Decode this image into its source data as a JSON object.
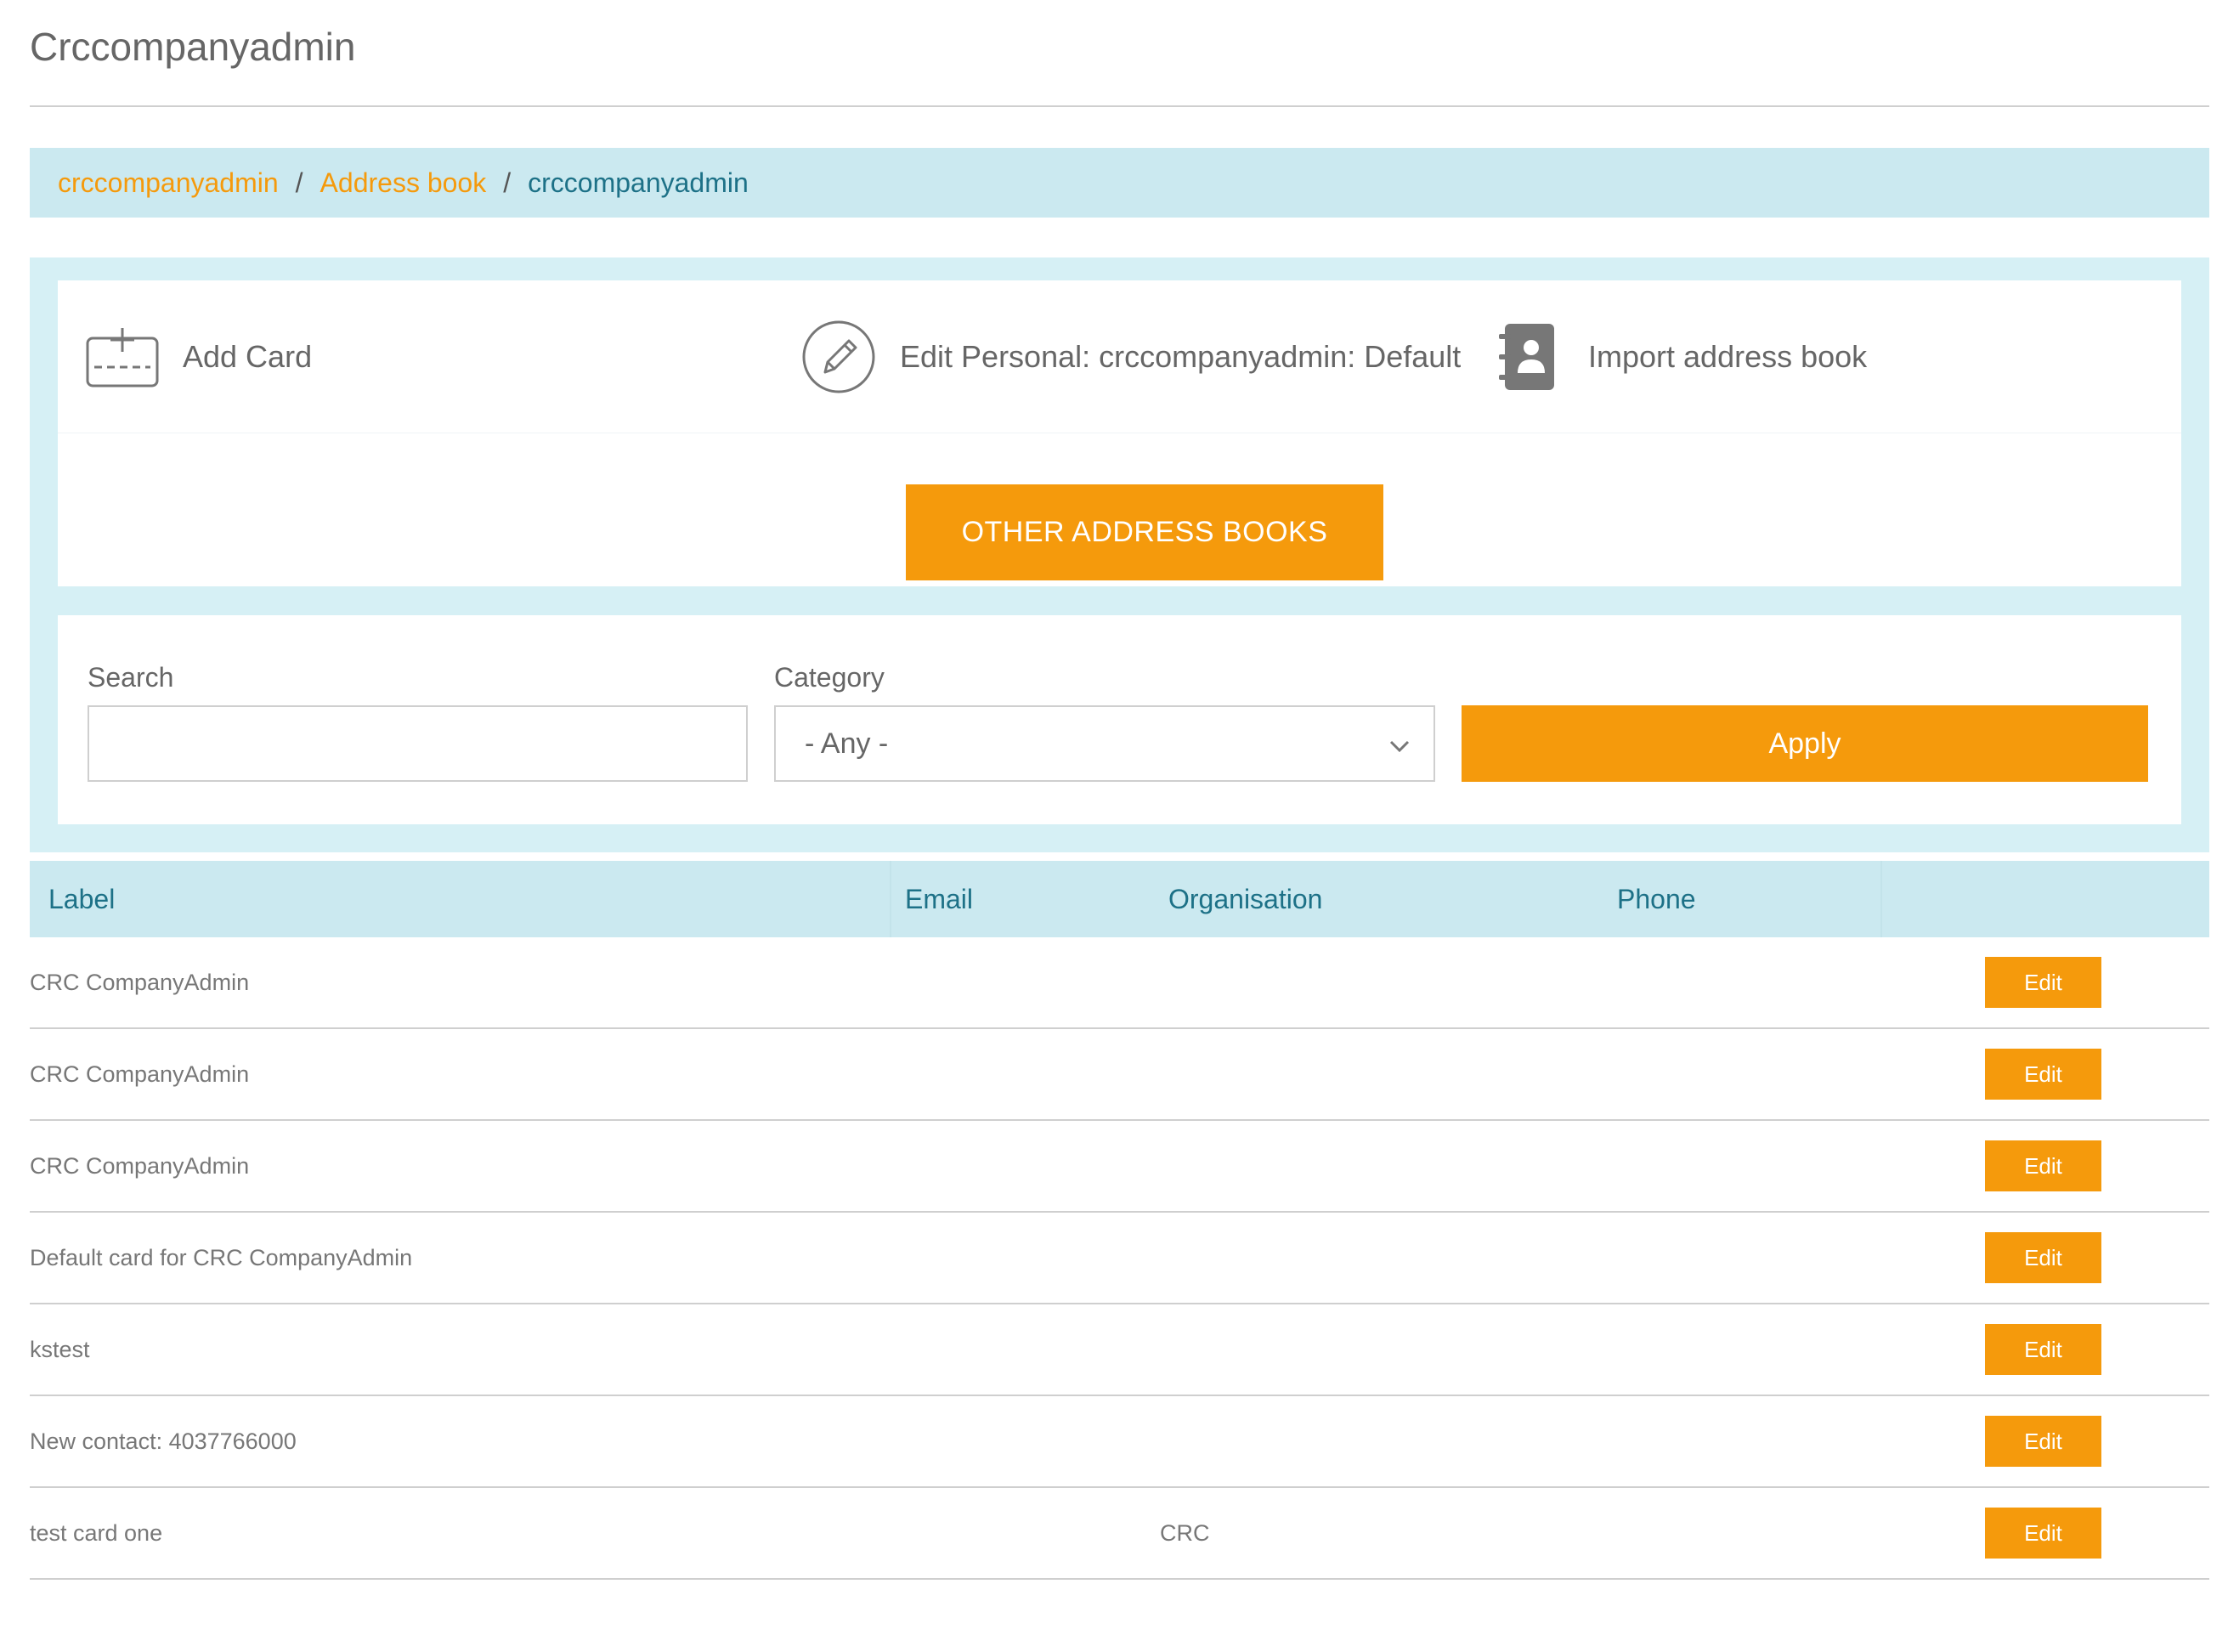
{
  "page": {
    "title": "Crccompanyadmin"
  },
  "breadcrumb": {
    "items": [
      "crccompanyadmin",
      "Address book"
    ],
    "separator": "/",
    "current": "crccompanyadmin"
  },
  "actions": {
    "add_card": {
      "label": "Add Card",
      "icon": "add-card-icon"
    },
    "edit_personal": {
      "label": "Edit Personal: crccompanyadmin: Default",
      "icon": "pencil-icon"
    },
    "import": {
      "label": "Import address book",
      "icon": "address-book-icon"
    },
    "other_books_label": "OTHER ADDRESS BOOKS"
  },
  "filters": {
    "search_label": "Search",
    "search_value": "",
    "category_label": "Category",
    "category_value": "- Any -",
    "apply_label": "Apply"
  },
  "table": {
    "columns": [
      "Label",
      "Email",
      "Organisation",
      "Phone"
    ],
    "rows": [
      {
        "label": "CRC CompanyAdmin",
        "email": "",
        "organisation": "",
        "phone": "",
        "action": "Edit"
      },
      {
        "label": "CRC CompanyAdmin",
        "email": "",
        "organisation": "",
        "phone": "",
        "action": "Edit"
      },
      {
        "label": "CRC CompanyAdmin",
        "email": "",
        "organisation": "",
        "phone": "",
        "action": "Edit"
      },
      {
        "label": "Default card for CRC CompanyAdmin",
        "email": "",
        "organisation": "",
        "phone": "",
        "action": "Edit"
      },
      {
        "label": "kstest",
        "email": "",
        "organisation": "",
        "phone": "",
        "action": "Edit"
      },
      {
        "label": "New contact: 4037766000",
        "email": "",
        "organisation": "",
        "phone": "",
        "action": "Edit"
      },
      {
        "label": "test card one",
        "email": "",
        "organisation": "CRC",
        "phone": "",
        "action": "Edit"
      }
    ]
  },
  "colors": {
    "accent": "#f59a0c",
    "header_bg": "#cbe9f0",
    "panel_bg": "#d6f0f5",
    "link_teal": "#1d7187"
  }
}
